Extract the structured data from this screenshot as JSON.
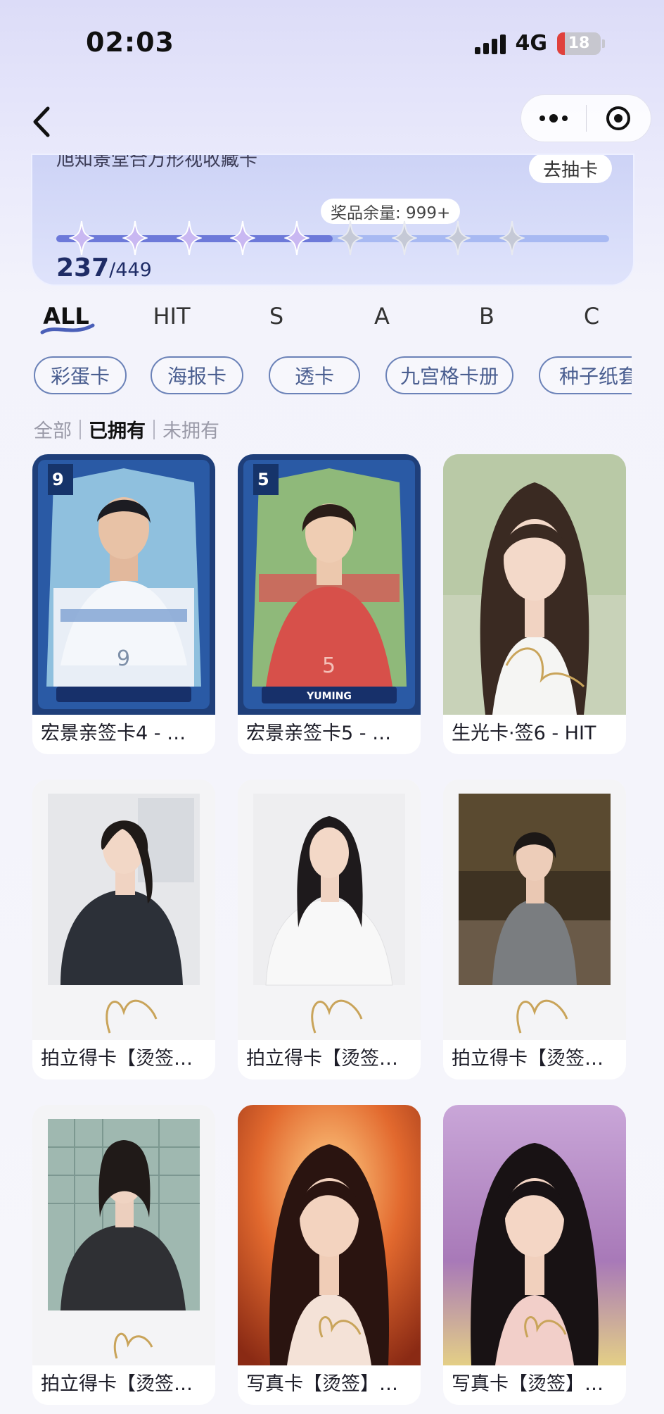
{
  "status_bar": {
    "time": "02:03",
    "network": "4G",
    "battery": "18"
  },
  "collection": {
    "subtitle": "旭知景堂合万形视收藏卡",
    "draw_button": "去抽卡",
    "prize_remaining": "奖品余量: 999+",
    "collected": "237",
    "total": "/449",
    "progress": 0.5
  },
  "rarity_tabs": [
    "ALL",
    "HIT",
    "S",
    "A",
    "B",
    "C"
  ],
  "active_rarity": "ALL",
  "type_chips": [
    "彩蛋卡",
    "海报卡",
    "透卡",
    "九宫格卡册",
    "种子纸套"
  ],
  "ownership_filter": {
    "all": "全部",
    "owned": "已拥有",
    "not_owned": "未拥有",
    "active": "已拥有"
  },
  "cards": [
    {
      "label": "宏景亲签卡4 - …",
      "art": "football-blue",
      "number": "9",
      "name_banner": ""
    },
    {
      "label": "宏景亲签卡5 - …",
      "art": "football-red",
      "number": "5",
      "name_banner": "YUMING"
    },
    {
      "label": "生光卡·签6 - HIT",
      "art": "portrait-white"
    },
    {
      "label": "拍立得卡【烫签…",
      "art": "polaroid-suit"
    },
    {
      "label": "拍立得卡【烫签…",
      "art": "polaroid-white"
    },
    {
      "label": "拍立得卡【烫签…",
      "art": "polaroid-night"
    },
    {
      "label": "拍立得卡【烫签…",
      "art": "polaroid-fence"
    },
    {
      "label": "写真卡【烫签】…",
      "art": "photo-orange"
    },
    {
      "label": "写真卡【烫签】…",
      "art": "photo-purple"
    }
  ],
  "colors": {
    "accent": "#6d79d9",
    "chip_border": "#6b82b8",
    "signature_gold": "#c9a45a"
  }
}
